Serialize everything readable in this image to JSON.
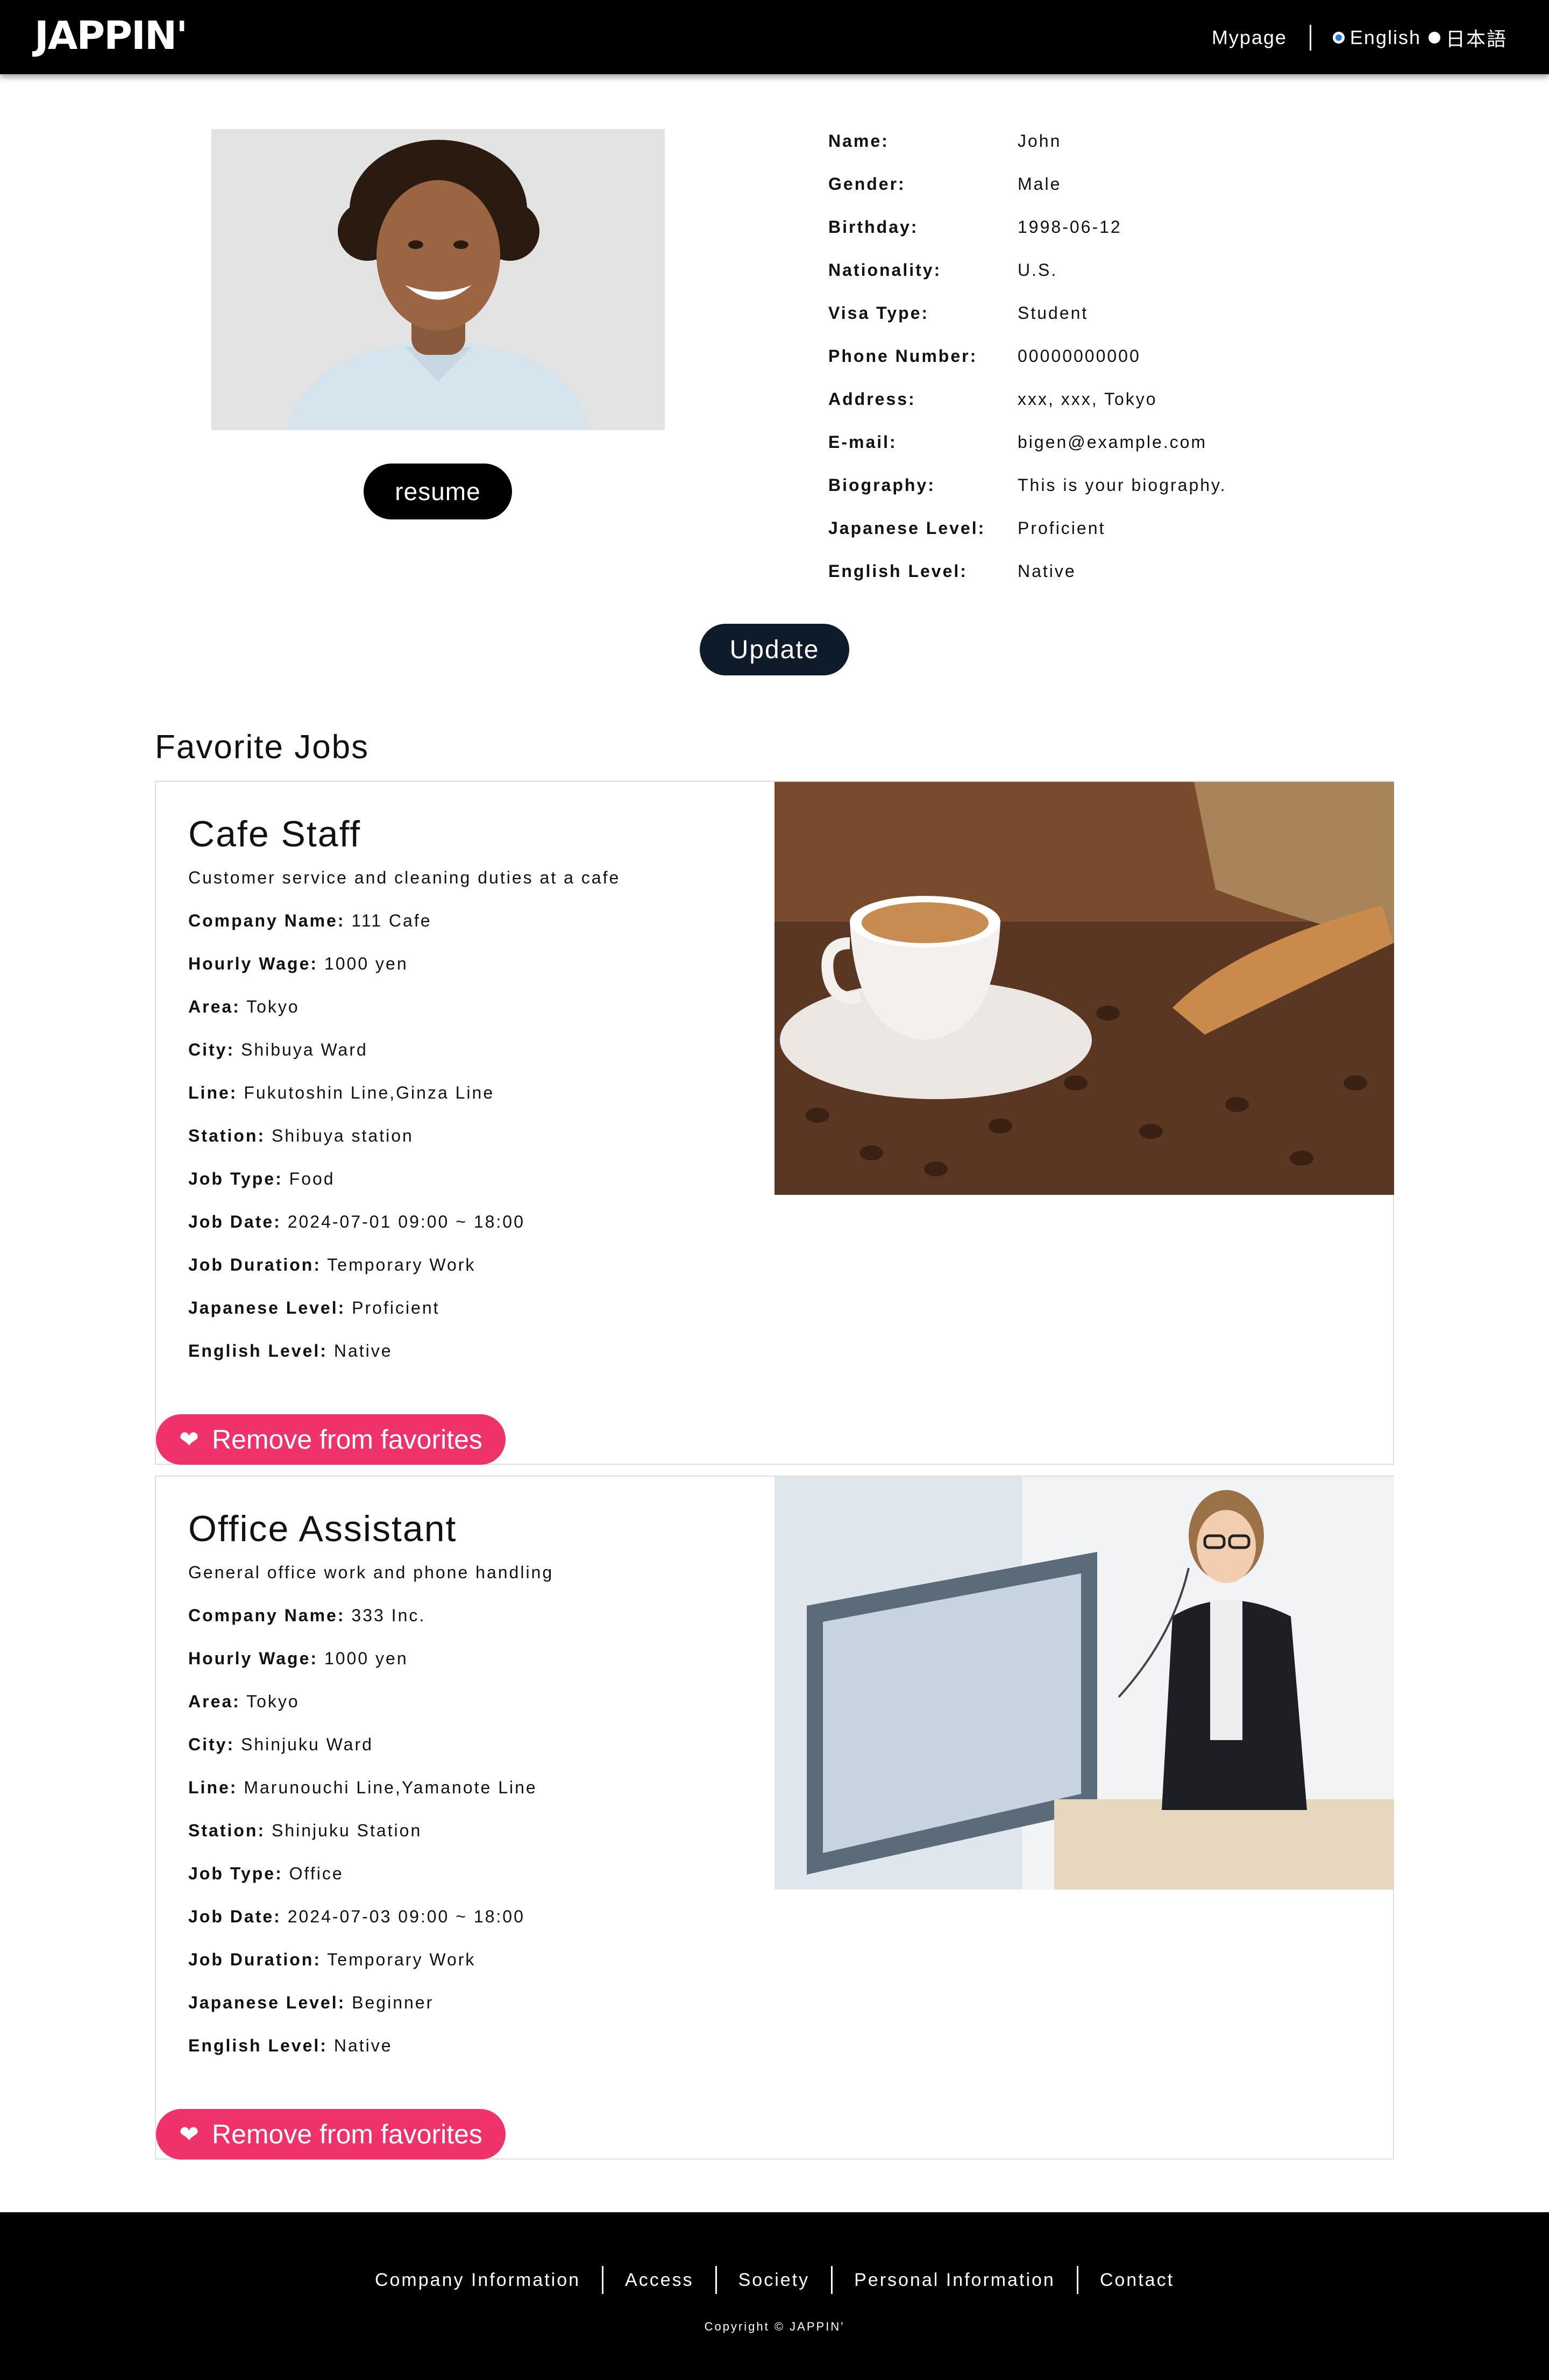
{
  "header": {
    "logo": "JAPPIN'",
    "mypage": "Mypage",
    "lang_english": "English",
    "lang_japanese": "日本語"
  },
  "profile": {
    "resume_label": "resume",
    "update_label": "Update",
    "fields": [
      {
        "key": "Name:",
        "value": "John"
      },
      {
        "key": "Gender:",
        "value": "Male"
      },
      {
        "key": "Birthday:",
        "value": "1998-06-12"
      },
      {
        "key": "Nationality:",
        "value": "U.S."
      },
      {
        "key": "Visa Type:",
        "value": "Student"
      },
      {
        "key": "Phone Number:",
        "value": "00000000000"
      },
      {
        "key": "Address:",
        "value": "xxx, xxx, Tokyo"
      },
      {
        "key": "E-mail:",
        "value": "bigen@example.com"
      },
      {
        "key": "Biography:",
        "value": "This is your biography."
      },
      {
        "key": "Japanese Level:",
        "value": "Proficient"
      },
      {
        "key": "English Level:",
        "value": "Native"
      }
    ]
  },
  "favorites": {
    "title": "Favorite Jobs",
    "remove_label": "Remove from favorites",
    "jobs": [
      {
        "title": "Cafe Staff",
        "description": "Customer service and cleaning duties at a cafe",
        "fields": [
          {
            "key": "Company Name:",
            "value": "111 Cafe"
          },
          {
            "key": "Hourly Wage:",
            "value": "1000 yen"
          },
          {
            "key": "Area:",
            "value": "Tokyo"
          },
          {
            "key": "City:",
            "value": "Shibuya Ward"
          },
          {
            "key": "Line:",
            "value": "Fukutoshin Line,Ginza Line"
          },
          {
            "key": "Station:",
            "value": "Shibuya station"
          },
          {
            "key": "Job Type:",
            "value": "Food"
          },
          {
            "key": "Job Date:",
            "value": "2024-07-01 09:00 ~ 18:00"
          },
          {
            "key": "Job Duration:",
            "value": "Temporary Work"
          },
          {
            "key": "Japanese Level:",
            "value": "Proficient"
          },
          {
            "key": "English Level:",
            "value": "Native"
          }
        ]
      },
      {
        "title": "Office Assistant",
        "description": "General office work and phone handling",
        "fields": [
          {
            "key": "Company Name:",
            "value": "333 Inc."
          },
          {
            "key": "Hourly Wage:",
            "value": "1000 yen"
          },
          {
            "key": "Area:",
            "value": "Tokyo"
          },
          {
            "key": "City:",
            "value": "Shinjuku Ward"
          },
          {
            "key": "Line:",
            "value": "Marunouchi Line,Yamanote Line"
          },
          {
            "key": "Station:",
            "value": "Shinjuku Station"
          },
          {
            "key": "Job Type:",
            "value": "Office"
          },
          {
            "key": "Job Date:",
            "value": "2024-07-03 09:00 ~ 18:00"
          },
          {
            "key": "Job Duration:",
            "value": "Temporary Work"
          },
          {
            "key": "Japanese Level:",
            "value": "Beginner"
          },
          {
            "key": "English Level:",
            "value": "Native"
          }
        ]
      }
    ]
  },
  "footer": {
    "links": [
      "Company Information",
      "Access",
      "Society",
      "Personal Information",
      "Contact"
    ],
    "copyright": "Copyright © JAPPIN'"
  },
  "colors": {
    "accent_pink": "#f0326b",
    "update_navy": "#0d1b2a",
    "radio_blue": "#1a7cf5"
  }
}
